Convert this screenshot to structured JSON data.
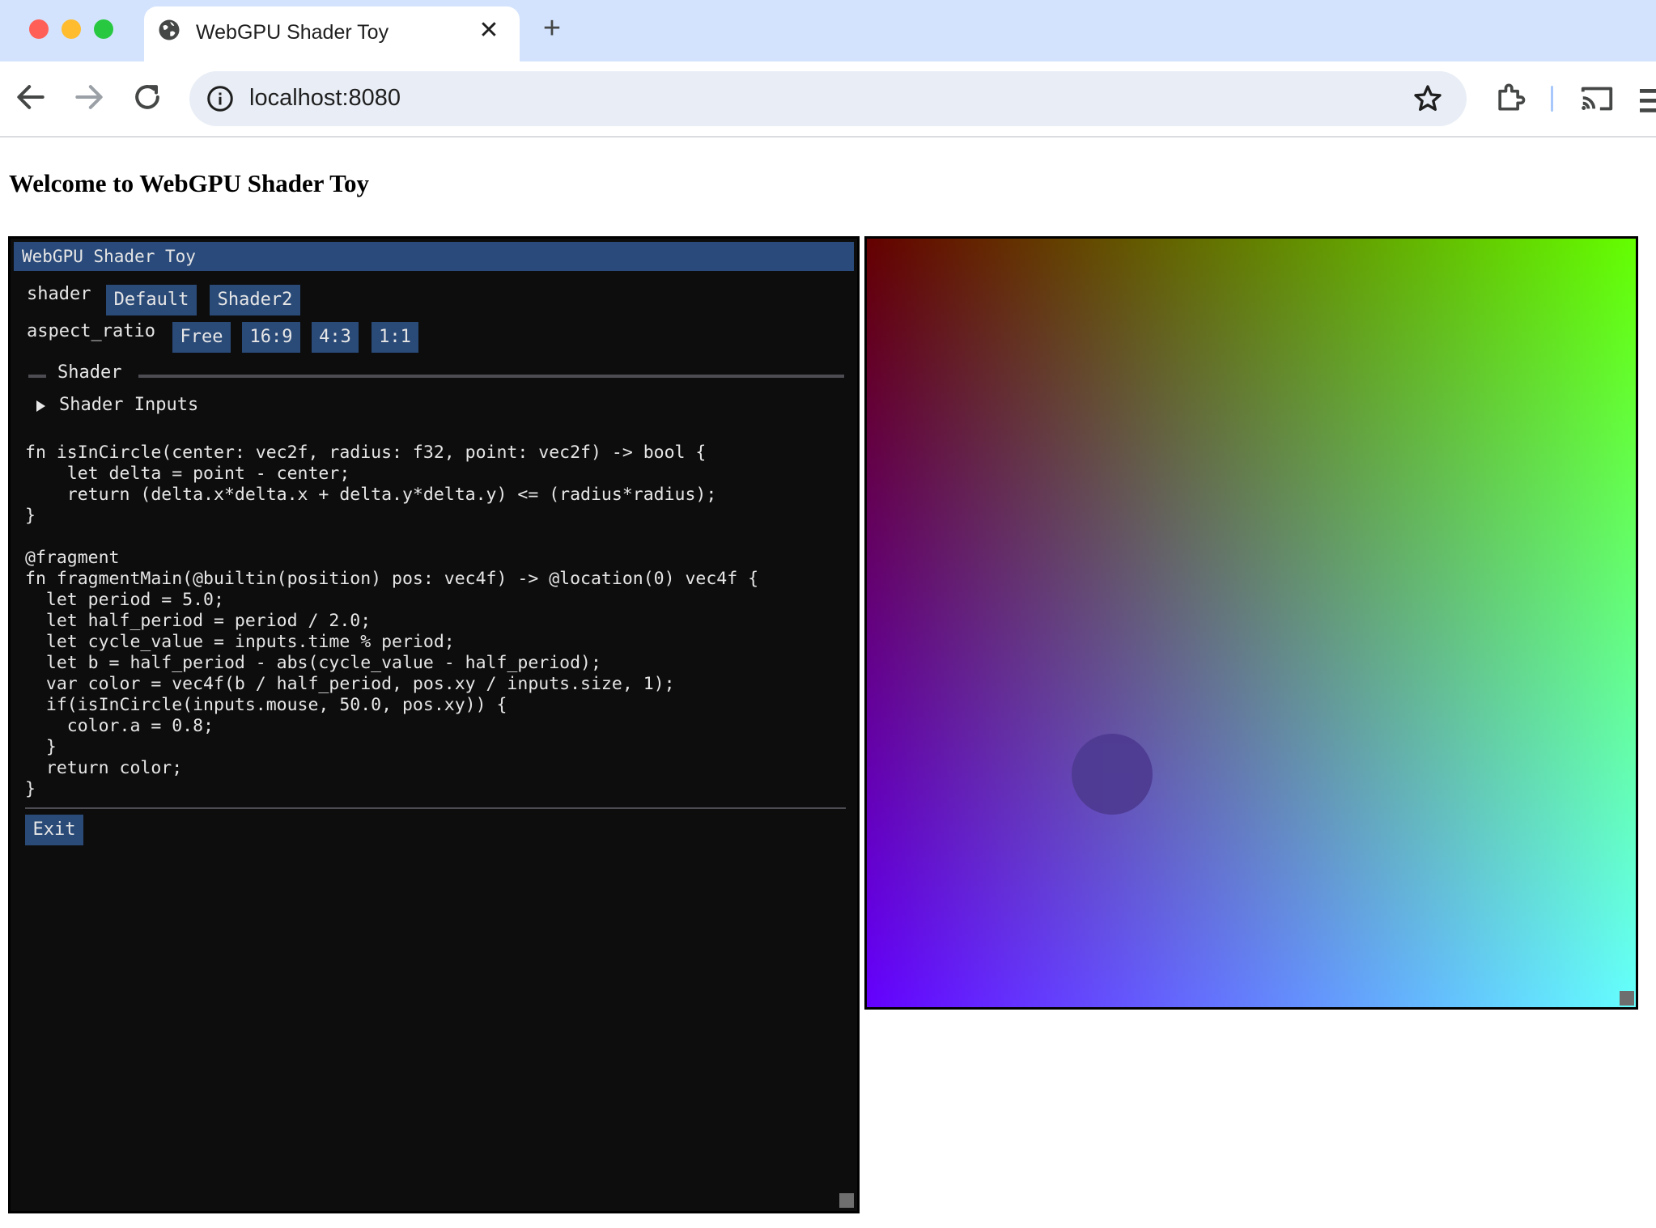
{
  "browser": {
    "tab_title": "WebGPU Shader Toy",
    "tab_close_glyph": "✕",
    "new_tab_glyph": "+",
    "url": "localhost:8080",
    "icons": [
      "globe-icon",
      "close-icon",
      "plus-icon",
      "back-arrow-icon",
      "forward-arrow-icon",
      "reload-icon",
      "info-icon",
      "star-icon",
      "extensions-icon",
      "cast-icon",
      "menu-icon"
    ]
  },
  "page": {
    "heading": "Welcome to WebGPU Shader Toy"
  },
  "gui": {
    "title": "WebGPU Shader Toy",
    "shader_label": "shader",
    "shader_options": [
      "Default",
      "Shader2"
    ],
    "aspect_label": "aspect_ratio",
    "aspect_options": [
      "Free",
      "16:9",
      "4:3",
      "1:1"
    ],
    "separator_label": "Shader",
    "tree_label": "Shader Inputs",
    "code": "fn isInCircle(center: vec2f, radius: f32, point: vec2f) -> bool {\n    let delta = point - center;\n    return (delta.x*delta.x + delta.y*delta.y) <= (radius*radius);\n}\n\n@fragment\nfn fragmentMain(@builtin(position) pos: vec4f) -> @location(0) vec4f {\n  let period = 5.0;\n  let half_period = period / 2.0;\n  let cycle_value = inputs.time % period;\n  let b = half_period - abs(cycle_value - half_period);\n  var color = vec4f(b / half_period, pos.xy / inputs.size, 1);\n  if(isInCircle(inputs.mouse, 50.0, pos.xy)) {\n    color.a = 0.8;\n  }\n  return color;\n}",
    "exit_label": "Exit"
  },
  "colors": {
    "button_bg": "#2a4a78",
    "title_bar": "#294a7a",
    "panel_bg": "#0d0d0d",
    "canvas_top_left": "#640000",
    "canvas_top_right": "#64ff00",
    "canvas_bottom_left": "#6400ff",
    "canvas_bottom_right": "#64ffff"
  }
}
